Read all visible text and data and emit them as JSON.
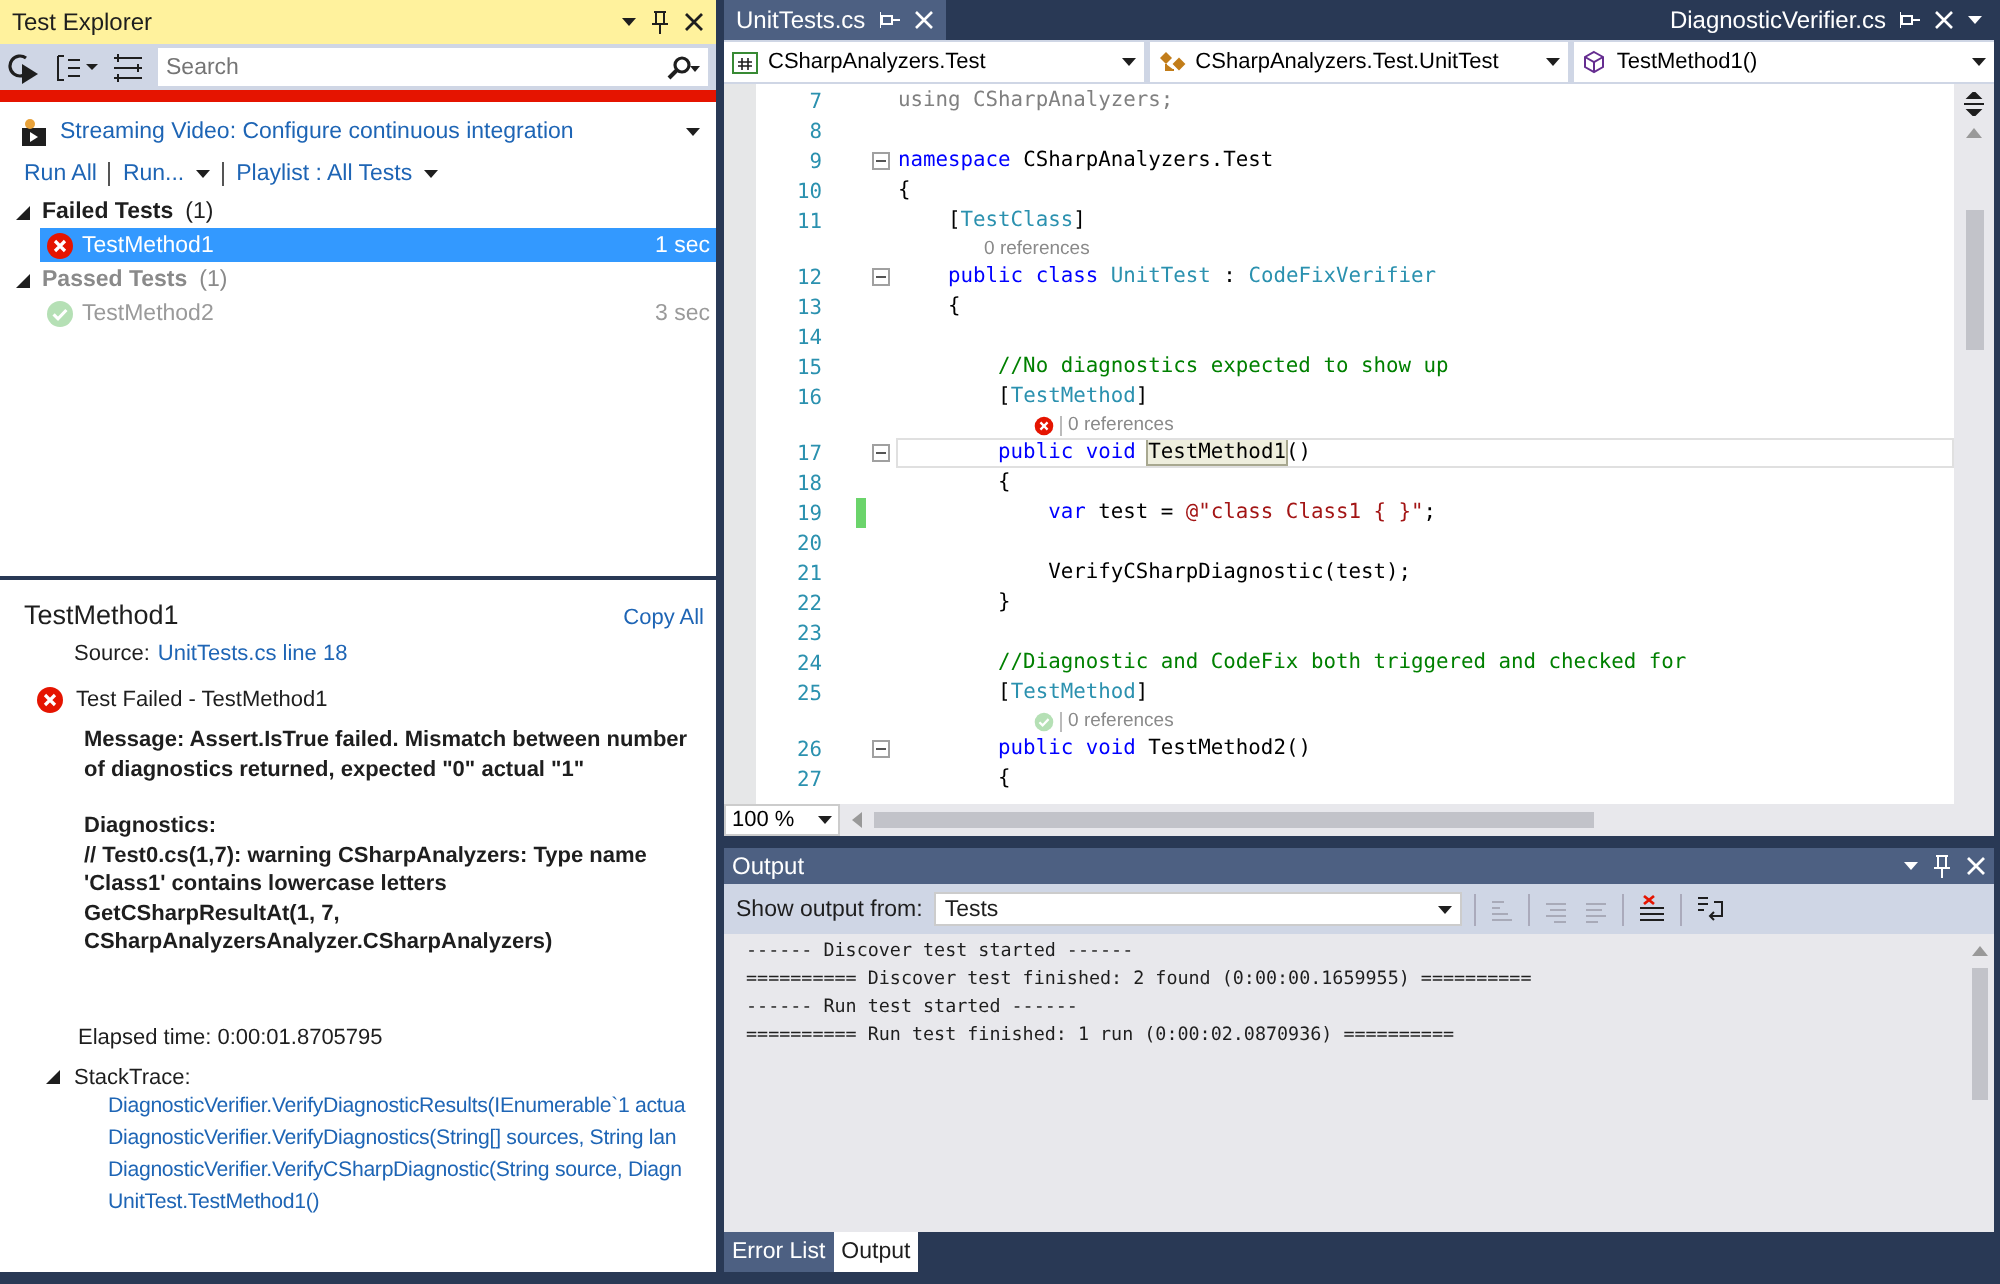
{
  "test_explorer": {
    "title": "Test Explorer",
    "search": {
      "placeholder": "Search"
    },
    "passed": false,
    "video_link": "Streaming Video: Configure continuous integration",
    "actions": [
      {
        "label": "Run All",
        "kind": "link"
      },
      {
        "label": "Run...",
        "kind": "menu"
      },
      {
        "label": "Playlist : All Tests",
        "kind": "menu"
      }
    ],
    "groups": [
      {
        "label": "Failed Tests",
        "count": "(1)",
        "expanded": true,
        "disabled": false,
        "tests": [
          {
            "name": "TestMethod1",
            "passed": false,
            "duration": "1 sec",
            "selected": true
          }
        ]
      },
      {
        "label": "Passed Tests",
        "count": "(1)",
        "expanded": true,
        "disabled": true,
        "tests": [
          {
            "name": "TestMethod2",
            "passed": true,
            "duration": "3 sec",
            "selected": false
          }
        ]
      }
    ]
  },
  "test_detail": {
    "title": "TestMethod1",
    "copy_link": "Copy All",
    "source_label": "Source:",
    "source_link": "UnitTests.cs line 18",
    "result": {
      "passed": false,
      "text": "Test Failed - TestMethod1"
    },
    "message": [
      "Message: Assert.IsTrue failed. Mismatch between number of diagnostics returned, expected \"0\" actual \"1\"",
      "Diagnostics:\n// Test0.cs(1,7): warning CSharpAnalyzers: Type name 'Class1' contains lowercase letters\nGetCSharpResultAt(1, 7, CSharpAnalyzersAnalyzer.CSharpAnalyzers)"
    ],
    "elapsed": "Elapsed time: 0:00:01.8705795",
    "stacktrace": {
      "label": "StackTrace:",
      "expanded": true,
      "frames": [
        "DiagnosticVerifier.VerifyDiagnosticResults(IEnumerable`1 actua",
        "DiagnosticVerifier.VerifyDiagnostics(String[] sources, String lan",
        "DiagnosticVerifier.VerifyCSharpDiagnostic(String source, Diagn",
        "UnitTest.TestMethod1()"
      ]
    }
  },
  "editor": {
    "tabs": [
      {
        "label": "UnitTests.cs",
        "kind": "document",
        "selected": true
      },
      {
        "label": "DiagnosticVerifier.cs",
        "kind": "preview",
        "selected": false
      }
    ],
    "nav": [
      {
        "kind": "project",
        "label": "CSharpAnalyzers.Test"
      },
      {
        "kind": "class",
        "label": "CSharpAnalyzers.Test.UnitTest"
      },
      {
        "kind": "method",
        "label": "TestMethod1()"
      }
    ],
    "lines": [
      {
        "kind": "code",
        "number": "7",
        "fold": false,
        "changed": false,
        "current": false,
        "segments": [
          {
            "kind": "unused",
            "text": "using CSharpAnalyzers;"
          }
        ]
      },
      {
        "kind": "code",
        "number": "8",
        "fold": false,
        "changed": false,
        "current": false
      },
      {
        "kind": "code",
        "number": "9",
        "fold": true,
        "changed": false,
        "current": false,
        "segments": [
          {
            "kind": "keyword",
            "text": "namespace"
          },
          {
            "kind": "plain",
            "text": " CSharpAnalyzers.Test"
          }
        ]
      },
      {
        "kind": "code",
        "number": "10",
        "fold": false,
        "changed": false,
        "current": false,
        "segments": [
          {
            "kind": "plain",
            "text": "{"
          }
        ]
      },
      {
        "kind": "code",
        "number": "11",
        "fold": false,
        "changed": false,
        "current": false,
        "segments": [
          {
            "kind": "plain",
            "text": "    ["
          },
          {
            "kind": "type",
            "text": "TestClass"
          },
          {
            "kind": "plain",
            "text": "]"
          }
        ]
      },
      {
        "kind": "lens",
        "tested": false,
        "text": "0 references"
      },
      {
        "kind": "code",
        "number": "12",
        "fold": true,
        "changed": false,
        "current": false,
        "segments": [
          {
            "kind": "keyword",
            "text": "    public"
          },
          {
            "kind": "keyword",
            "text": " class"
          },
          {
            "kind": "type",
            "text": " UnitTest"
          },
          {
            "kind": "plain",
            "text": " : "
          },
          {
            "kind": "type",
            "text": "CodeFixVerifier"
          }
        ]
      },
      {
        "kind": "code",
        "number": "13",
        "fold": false,
        "changed": false,
        "current": false,
        "segments": [
          {
            "kind": "plain",
            "text": "    {"
          }
        ]
      },
      {
        "kind": "code",
        "number": "14",
        "fold": false,
        "changed": false,
        "current": false
      },
      {
        "kind": "code",
        "number": "15",
        "fold": false,
        "changed": false,
        "current": false,
        "segments": [
          {
            "kind": "comment",
            "text": "        //No diagnostics expected to show up"
          }
        ]
      },
      {
        "kind": "code",
        "number": "16",
        "fold": false,
        "changed": false,
        "current": false,
        "segments": [
          {
            "kind": "plain",
            "text": "        ["
          },
          {
            "kind": "type",
            "text": "TestMethod"
          },
          {
            "kind": "plain",
            "text": "]"
          }
        ]
      },
      {
        "kind": "lens",
        "tested": true,
        "passed": false,
        "text": "0 references"
      },
      {
        "kind": "code",
        "number": "17",
        "fold": true,
        "changed": false,
        "current": true,
        "segments": [
          {
            "kind": "keyword",
            "text": "        public"
          },
          {
            "kind": "keyword",
            "text": " void "
          },
          {
            "kind": "highlight",
            "text": "TestMethod1"
          },
          {
            "kind": "plain",
            "text": "()"
          }
        ]
      },
      {
        "kind": "code",
        "number": "18",
        "fold": false,
        "changed": false,
        "current": false,
        "segments": [
          {
            "kind": "plain",
            "text": "        {"
          }
        ]
      },
      {
        "kind": "code",
        "number": "19",
        "fold": false,
        "changed": true,
        "current": false,
        "segments": [
          {
            "kind": "keyword",
            "text": "            var"
          },
          {
            "kind": "plain",
            "text": " test = "
          },
          {
            "kind": "string",
            "text": "@\"class Class1 { }\""
          },
          {
            "kind": "plain",
            "text": ";"
          }
        ]
      },
      {
        "kind": "code",
        "number": "20",
        "fold": false,
        "changed": false,
        "current": false
      },
      {
        "kind": "code",
        "number": "21",
        "fold": false,
        "changed": false,
        "current": false,
        "segments": [
          {
            "kind": "plain",
            "text": "            VerifyCSharpDiagnostic(test);"
          }
        ]
      },
      {
        "kind": "code",
        "number": "22",
        "fold": false,
        "changed": false,
        "current": false,
        "segments": [
          {
            "kind": "plain",
            "text": "        }"
          }
        ]
      },
      {
        "kind": "code",
        "number": "23",
        "fold": false,
        "changed": false,
        "current": false
      },
      {
        "kind": "code",
        "number": "24",
        "fold": false,
        "changed": false,
        "current": false,
        "segments": [
          {
            "kind": "comment",
            "text": "        //Diagnostic and CodeFix both triggered and checked for"
          }
        ]
      },
      {
        "kind": "code",
        "number": "25",
        "fold": false,
        "changed": false,
        "current": false,
        "segments": [
          {
            "kind": "plain",
            "text": "        ["
          },
          {
            "kind": "type",
            "text": "TestMethod"
          },
          {
            "kind": "plain",
            "text": "]"
          }
        ]
      },
      {
        "kind": "lens",
        "tested": true,
        "passed": true,
        "text": "0 references"
      },
      {
        "kind": "code",
        "number": "26",
        "fold": true,
        "changed": false,
        "current": false,
        "segments": [
          {
            "kind": "keyword",
            "text": "        public"
          },
          {
            "kind": "keyword",
            "text": " void"
          },
          {
            "kind": "plain",
            "text": " TestMethod2()"
          }
        ]
      },
      {
        "kind": "code",
        "number": "27",
        "fold": false,
        "changed": false,
        "current": false,
        "segments": [
          {
            "kind": "plain",
            "text": "        {"
          }
        ]
      }
    ],
    "zoom": "100 %"
  },
  "output": {
    "title": "Output",
    "source_label": "Show output from:",
    "source": "Tests",
    "lines": [
      "------ Discover test started ------",
      "========== Discover test finished: 2 found (0:00:00.1659955) ==========",
      "------ Run test started ------",
      "========== Run test finished: 1 run (0:00:02.0870936) =========="
    ],
    "tabs": [
      {
        "label": "Error List",
        "selected": false
      },
      {
        "label": "Output",
        "selected": true
      }
    ]
  }
}
